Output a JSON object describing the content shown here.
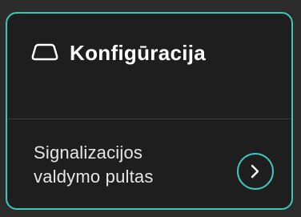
{
  "card": {
    "title": "Konfigūracija",
    "title_icon": "rounded-shape-icon",
    "items": [
      {
        "label_line1": "Signalizacijos",
        "label_line2": "valdymo pultas",
        "action_icon": "chevron-right-icon"
      }
    ]
  },
  "colors": {
    "background": "#2b2b2b",
    "card_background": "#1e1e1e",
    "accent": "#3cc8b8",
    "text_primary": "#ffffff",
    "text_secondary": "#e6e6e6"
  }
}
